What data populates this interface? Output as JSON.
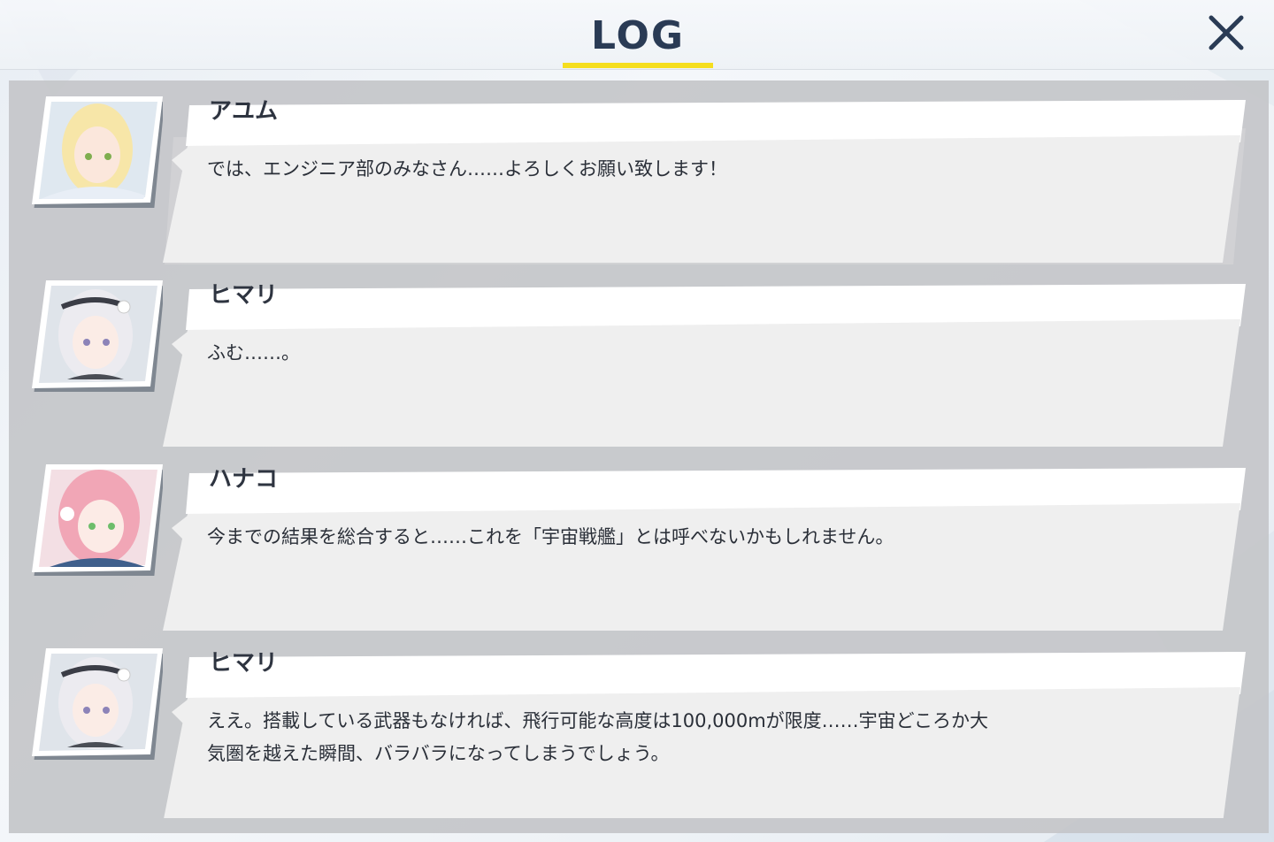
{
  "header": {
    "title": "LOG",
    "close_icon": "close-icon"
  },
  "colors": {
    "title": "#2a3b55",
    "underline": "#f5de1e",
    "panel": "#c4c6c9",
    "bubble": "#efefef",
    "nameplate": "#ffffff"
  },
  "entries": [
    {
      "speaker": "アユム",
      "message": "では、エンジニア部のみなさん……よろしくお願い致します！",
      "avatar": "ayumu-portrait"
    },
    {
      "speaker": "ヒマリ",
      "message": "ふむ……。",
      "avatar": "himari-portrait"
    },
    {
      "speaker": "ハナコ",
      "message": "今までの結果を総合すると……これを「宇宙戦艦」とは呼べないかもしれません。",
      "avatar": "hanako-portrait"
    },
    {
      "speaker": "ヒマリ",
      "message": "ええ。搭載している武器もなければ、飛行可能な高度は100,000mが限度……宇宙どころか大\n気圏を越えた瞬間、バラバラになってしまうでしょう。",
      "avatar": "himari-portrait"
    }
  ]
}
